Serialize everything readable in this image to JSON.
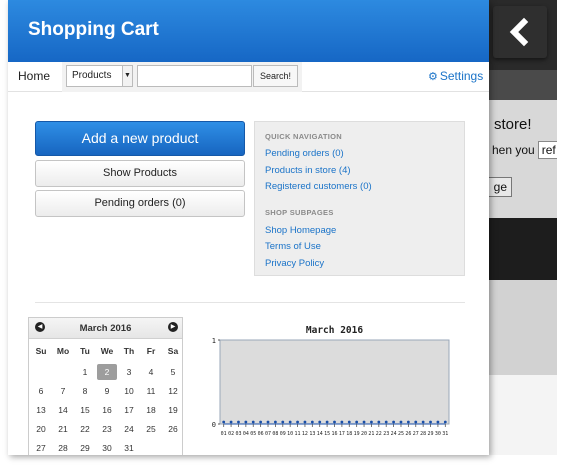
{
  "header": {
    "title": "Shopping Cart"
  },
  "back_button": {
    "icon": "chevron-left-icon"
  },
  "navbar": {
    "home_label": "Home",
    "search_select": "Products",
    "search_input_value": "",
    "search_button": "Search!",
    "settings_label": "Settings",
    "settings_icon": "gear-icon"
  },
  "actions": {
    "add_product": "Add a new product",
    "show_products": "Show Products",
    "pending_orders": "Pending orders (0)"
  },
  "quick_nav": {
    "heading": "QUICK NAVIGATION",
    "links": [
      "Pending orders (0)",
      "Products in store (4)",
      "Registered customers (0)"
    ],
    "subpages_heading": "SHOP SUBPAGES",
    "subpage_links": [
      "Shop Homepage",
      "Terms of Use",
      "Privacy Policy"
    ]
  },
  "calendar": {
    "title": "March 2016",
    "weekdays": [
      "Su",
      "Mo",
      "Tu",
      "We",
      "Th",
      "Fr",
      "Sa"
    ],
    "selected_day": "2",
    "weeks": [
      [
        "",
        "",
        "1",
        "2",
        "3",
        "4",
        "5"
      ],
      [
        "6",
        "7",
        "8",
        "9",
        "10",
        "11",
        "12"
      ],
      [
        "13",
        "14",
        "15",
        "16",
        "17",
        "18",
        "19"
      ],
      [
        "20",
        "21",
        "22",
        "23",
        "24",
        "25",
        "26"
      ],
      [
        "27",
        "28",
        "29",
        "30",
        "31",
        "",
        ""
      ]
    ]
  },
  "background_page": {
    "text1": "store!",
    "text2": "hen you",
    "ref_text": "ref",
    "button_text": "ge"
  },
  "chart_data": {
    "type": "line",
    "title": "March 2016",
    "categories": [
      "01",
      "02",
      "03",
      "04",
      "05",
      "06",
      "07",
      "08",
      "09",
      "10",
      "11",
      "12",
      "13",
      "14",
      "15",
      "16",
      "17",
      "18",
      "19",
      "20",
      "21",
      "22",
      "23",
      "24",
      "25",
      "26",
      "27",
      "28",
      "29",
      "30",
      "31"
    ],
    "values": [
      0,
      0,
      0,
      0,
      0,
      0,
      0,
      0,
      0,
      0,
      0,
      0,
      0,
      0,
      0,
      0,
      0,
      0,
      0,
      0,
      0,
      0,
      0,
      0,
      0,
      0,
      0,
      0,
      0,
      0,
      0
    ],
    "ylim": [
      0,
      1
    ],
    "yticks": [
      "0",
      "1"
    ],
    "colors": {
      "plot_bg": "#dcdcdc",
      "line": "#1a4fa8"
    }
  }
}
